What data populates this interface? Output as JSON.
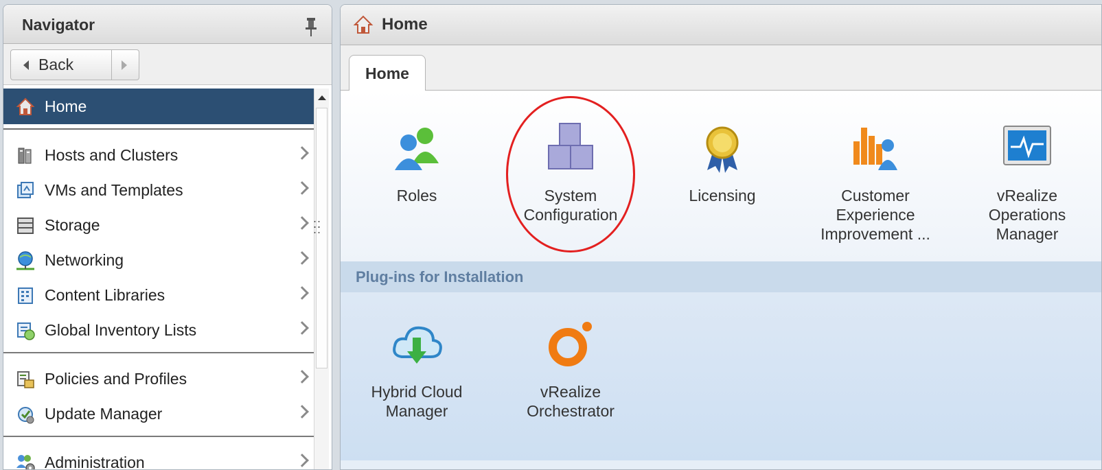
{
  "navigator": {
    "title": "Navigator",
    "back_label": "Back",
    "items_group1": [
      {
        "label": "Home",
        "icon": "home-icon",
        "active": true
      }
    ],
    "items_group2": [
      {
        "label": "Hosts and Clusters",
        "icon": "hosts-clusters-icon"
      },
      {
        "label": "VMs and Templates",
        "icon": "vms-templates-icon"
      },
      {
        "label": "Storage",
        "icon": "storage-icon"
      },
      {
        "label": "Networking",
        "icon": "networking-icon"
      },
      {
        "label": "Content Libraries",
        "icon": "content-libraries-icon"
      },
      {
        "label": "Global Inventory Lists",
        "icon": "global-inventory-icon"
      }
    ],
    "items_group3": [
      {
        "label": "Policies and Profiles",
        "icon": "policies-profiles-icon"
      },
      {
        "label": "Update Manager",
        "icon": "update-manager-icon"
      }
    ],
    "items_group4": [
      {
        "label": "Administration",
        "icon": "administration-icon"
      }
    ]
  },
  "main": {
    "title": "Home",
    "tab_label": "Home",
    "tiles": [
      {
        "label": "Roles",
        "icon": "roles-icon"
      },
      {
        "label": "System\nConfiguration",
        "icon": "system-configuration-icon"
      },
      {
        "label": "Licensing",
        "icon": "licensing-icon"
      },
      {
        "label": "Customer\nExperience\nImprovement ...",
        "icon": "customer-experience-icon"
      },
      {
        "label": "vRealize\nOperations\nManager",
        "icon": "vrealize-operations-icon"
      }
    ],
    "plugins_title": "Plug-ins for Installation",
    "plugins": [
      {
        "label": "Hybrid Cloud\nManager",
        "icon": "hybrid-cloud-icon"
      },
      {
        "label": "vRealize\nOrchestrator",
        "icon": "vrealize-orchestrator-icon"
      }
    ]
  },
  "colors": {
    "active_item": "#2c4f73",
    "plugins_title": "#5f7ea1",
    "annotation": "#e32020"
  }
}
